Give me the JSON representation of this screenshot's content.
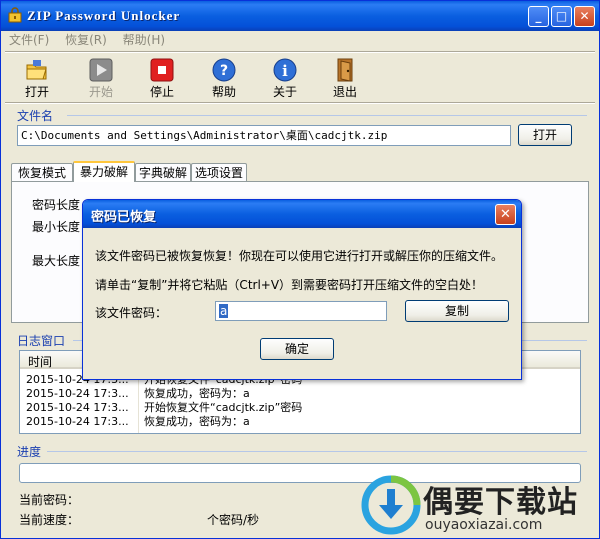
{
  "window": {
    "title": "ZIP Password Unlocker",
    "controls": {
      "minimize": "_",
      "maximize": "□",
      "close": "✕"
    }
  },
  "menu": [
    "文件(F)",
    "恢复(R)",
    "帮助(H)"
  ],
  "toolbar": [
    {
      "label": "打开",
      "icon": "folder-open-icon",
      "enabled": true
    },
    {
      "label": "开始",
      "icon": "play-icon",
      "enabled": false
    },
    {
      "label": "停止",
      "icon": "stop-icon",
      "enabled": true
    },
    {
      "label": "帮助",
      "icon": "help-icon",
      "enabled": true
    },
    {
      "label": "关于",
      "icon": "info-icon",
      "enabled": true
    },
    {
      "label": "退出",
      "icon": "exit-door-icon",
      "enabled": true
    }
  ],
  "file": {
    "section_title": "文件名",
    "path": "C:\\Documents and Settings\\Administrator\\桌面\\cadcjtk.zip",
    "open_button": "打开"
  },
  "tabs": [
    "恢复模式",
    "暴力破解",
    "字典破解",
    "选项设置"
  ],
  "active_tab": "暴力破解",
  "brute_force": {
    "password_length_label": "密码长度",
    "min_length_label": "最小长度",
    "max_length_label": "最大长度"
  },
  "log": {
    "section_title": "日志窗口",
    "column_time": "时间",
    "rows": [
      {
        "time": "2015-10-24 17:3...",
        "message": "开始恢复文件“cadcjtk.zip”密码"
      },
      {
        "time": "2015-10-24 17:3...",
        "message": "恢复成功，密码为：a"
      },
      {
        "time": "2015-10-24 17:3...",
        "message": "开始恢复文件“cadcjtk.zip”密码"
      },
      {
        "time": "2015-10-24 17:3...",
        "message": "恢复成功，密码为：a"
      }
    ]
  },
  "progress": {
    "section_title": "进度",
    "value": 0,
    "current_password_label": "当前密码：",
    "current_speed_label": "当前速度：",
    "speed_unit": "个密码/秒"
  },
  "dialog": {
    "title": "密码已恢复",
    "line1": "该文件密码已被恢复恢复！你现在可以使用它进行打开或解压你的压缩文件。",
    "line2": "请单击“复制”并将它粘贴（Ctrl+V）到需要密码打开压缩文件的空白处！",
    "password_label": "该文件密码：",
    "password_value": "a",
    "copy_button": "复制",
    "ok_button": "确定"
  },
  "watermark": {
    "brand": "偶要下载站",
    "url": "ouyaoxiazai.com"
  },
  "colors": {
    "title_bar": "#0a5fe0",
    "face": "#ece9d8",
    "section_title": "#1a3fb0",
    "tab_highlight": "#ffc73c",
    "selection": "#316ac5"
  }
}
